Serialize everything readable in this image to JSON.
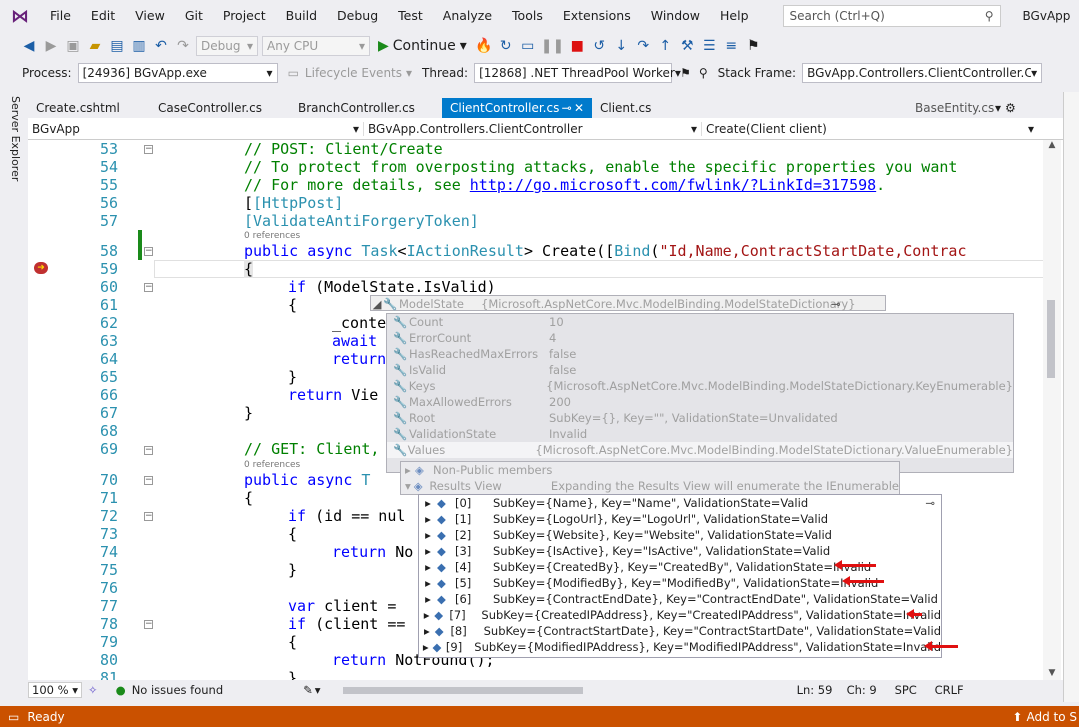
{
  "menu": {
    "items": [
      "File",
      "Edit",
      "View",
      "Git",
      "Project",
      "Build",
      "Debug",
      "Test",
      "Analyze",
      "Tools",
      "Extensions",
      "Window",
      "Help"
    ],
    "search_placeholder": "Search (Ctrl+Q)",
    "solution_name": "BGvApp"
  },
  "toolbar": {
    "config": "Debug",
    "platform": "Any CPU",
    "continue_label": "Continue"
  },
  "debug_bar": {
    "process_label": "Process:",
    "process_value": "[24936] BGvApp.exe",
    "lifecycle_label": "Lifecycle Events",
    "thread_label": "Thread:",
    "thread_value": "[12868] .NET ThreadPool Worker",
    "stack_label": "Stack Frame:",
    "stack_value": "BGvApp.Controllers.ClientController.Creat"
  },
  "side_panel": {
    "label": "Server Explorer"
  },
  "tabs": [
    {
      "label": "Create.cshtml"
    },
    {
      "label": "CaseController.cs"
    },
    {
      "label": "BranchController.cs"
    },
    {
      "label": "ClientController.cs"
    },
    {
      "label": "Client.cs"
    },
    {
      "label": "BaseEntity.cs"
    }
  ],
  "navbar": {
    "project": "BGvApp",
    "class": "BGvApp.Controllers.ClientController",
    "member": "Create(Client client)"
  },
  "code": {
    "line_numbers": [
      "53",
      "54",
      "55",
      "56",
      "57",
      "58",
      "59",
      "60",
      "61",
      "62",
      "63",
      "64",
      "65",
      "66",
      "67",
      "68",
      "69",
      "70",
      "71",
      "72",
      "73",
      "74",
      "75",
      "76",
      "77",
      "78",
      "79",
      "80",
      "81"
    ],
    "refs_label": "0 references",
    "l53": "// POST: Client/Create",
    "l54": "// To protect from overposting attacks, enable the specific properties you want",
    "l55_pre": "// For more details, see ",
    "l55_link": "http://go.microsoft.com/fwlink/?LinkId=317598",
    "l55_post": ".",
    "l56": "[HttpPost]",
    "l57": "[ValidateAntiForgeryToken]",
    "l58_kw": "public async ",
    "l58_ty": "Task",
    "l58_mid": "<",
    "l58_ty2": "IActionResult",
    "l58_rest": "> Create([",
    "l58_ty3": "Bind",
    "l58_paren": "(",
    "l58_str": "\"Id,Name,ContractStartDate,Contrac",
    "l59": "{",
    "l60_kw": "if",
    "l60_rest": " (ModelState.IsValid)",
    "l61": "{",
    "l62": "_conte",
    "l63_kw": "await",
    "l64_kw": "return",
    "l65": "}",
    "l66_kw": "return",
    "l66_rest": " Vie",
    "l67": "}",
    "l69": "// GET: Client,",
    "l70_kw": "public async ",
    "l70_ty": "T",
    "l71": "{",
    "l72_kw": "if",
    "l72_rest": " (id == nul",
    "l73": "{",
    "l74_kw": "return",
    "l74_rest": " No",
    "l75": "}",
    "l77_kw": "var",
    "l77_rest": " client = ",
    "l78_kw": "if",
    "l78_rest": " (client ==",
    "l79": "{",
    "l80_kw": "return",
    "l80_rest": " NotFound();",
    "l81": "}"
  },
  "tooltip": {
    "root_name": "ModelState",
    "root_value": "{Microsoft.AspNetCore.Mvc.ModelBinding.ModelStateDictionary}",
    "rows": [
      {
        "name": "Count",
        "value": "10"
      },
      {
        "name": "ErrorCount",
        "value": "4"
      },
      {
        "name": "HasReachedMaxErrors",
        "value": "false"
      },
      {
        "name": "IsValid",
        "value": "false"
      },
      {
        "name": "Keys",
        "value": "{Microsoft.AspNetCore.Mvc.ModelBinding.ModelStateDictionary.KeyEnumerable}"
      },
      {
        "name": "MaxAllowedErrors",
        "value": "200"
      },
      {
        "name": "Root",
        "value": "SubKey={}, Key=\"\", ValidationState=Unvalidated"
      },
      {
        "name": "ValidationState",
        "value": "Invalid"
      },
      {
        "name": "Values",
        "value": "{Microsoft.AspNetCore.Mvc.ModelBinding.ModelStateDictionary.ValueEnumerable}"
      }
    ],
    "non_public": "Non-Public members",
    "results_view": "Results View",
    "results_hint": "Expanding the Results View will enumerate the IEnumerable"
  },
  "results": [
    {
      "index": "[0]",
      "value": "SubKey={Name}, Key=\"Name\", ValidationState=Valid"
    },
    {
      "index": "[1]",
      "value": "SubKey={LogoUrl}, Key=\"LogoUrl\", ValidationState=Valid"
    },
    {
      "index": "[2]",
      "value": "SubKey={Website}, Key=\"Website\", ValidationState=Valid"
    },
    {
      "index": "[3]",
      "value": "SubKey={IsActive}, Key=\"IsActive\", ValidationState=Valid"
    },
    {
      "index": "[4]",
      "value": "SubKey={CreatedBy}, Key=\"CreatedBy\", ValidationState=Invalid"
    },
    {
      "index": "[5]",
      "value": "SubKey={ModifiedBy}, Key=\"ModifiedBy\", ValidationState=Invalid"
    },
    {
      "index": "[6]",
      "value": "SubKey={ContractEndDate}, Key=\"ContractEndDate\", ValidationState=Valid"
    },
    {
      "index": "[7]",
      "value": "SubKey={CreatedIPAddress}, Key=\"CreatedIPAddress\", ValidationState=Invalid"
    },
    {
      "index": "[8]",
      "value": "SubKey={ContractStartDate}, Key=\"ContractStartDate\", ValidationState=Valid"
    },
    {
      "index": "[9]",
      "value": "SubKey={ModifiedIPAddress}, Key=\"ModifiedIPAddress\", ValidationState=Invalid"
    }
  ],
  "editor_footer": {
    "zoom": "100 %",
    "issues": "No issues found",
    "line": "Ln: 59",
    "col": "Ch: 9",
    "ins": "SPC",
    "eol": "CRLF"
  },
  "status": {
    "ready": "Ready",
    "add_to": "Add to S"
  },
  "colors": {
    "accent": "#007acc",
    "status_bar": "#ca5100",
    "annotation_arrow": "#e01010"
  }
}
